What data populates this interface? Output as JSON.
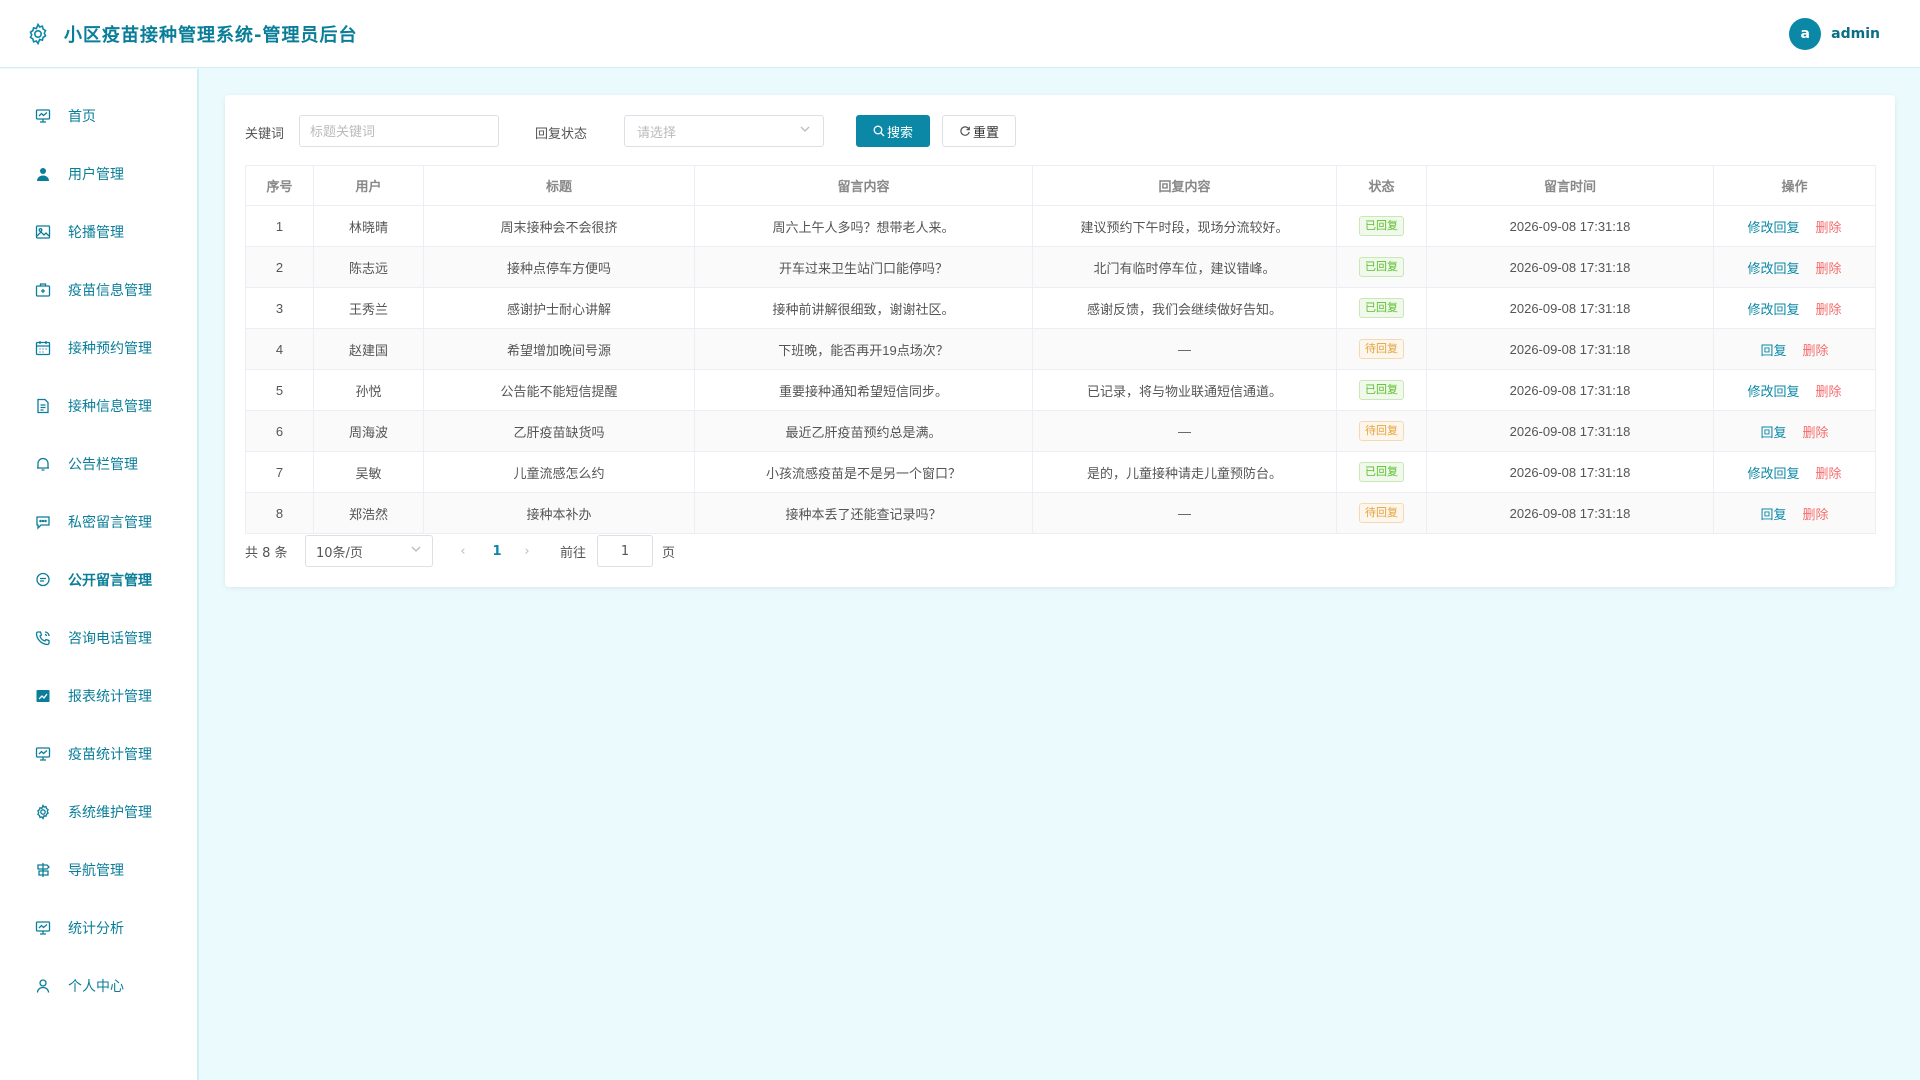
{
  "app": {
    "title": "小区疫苗接种管理系统-管理员后台",
    "accent": "#0a88a6"
  },
  "user": {
    "avatar_letter": "a",
    "name": "admin"
  },
  "sidebar": {
    "items": [
      {
        "label": "首页",
        "icon": "monitor-icon"
      },
      {
        "label": "用户管理",
        "icon": "user-icon"
      },
      {
        "label": "轮播管理",
        "icon": "picture-icon"
      },
      {
        "label": "疫苗信息管理",
        "icon": "first-aid-kit-icon"
      },
      {
        "label": "接种预约管理",
        "icon": "calendar-icon"
      },
      {
        "label": "接种信息管理",
        "icon": "document-icon"
      },
      {
        "label": "公告栏管理",
        "icon": "bell-icon"
      },
      {
        "label": "私密留言管理",
        "icon": "chat-dots-icon"
      },
      {
        "label": "公开留言管理",
        "icon": "chat-line-icon",
        "active": true
      },
      {
        "label": "咨询电话管理",
        "icon": "phone-icon"
      },
      {
        "label": "报表统计管理",
        "icon": "data-line-icon"
      },
      {
        "label": "疫苗统计管理",
        "icon": "monitor-icon"
      },
      {
        "label": "系统维护管理",
        "icon": "setting-icon"
      },
      {
        "label": "导航管理",
        "icon": "guide-icon"
      },
      {
        "label": "统计分析",
        "icon": "monitor-icon"
      },
      {
        "label": "个人中心",
        "icon": "user-outline-icon"
      }
    ]
  },
  "filter": {
    "keyword_label": "关键词",
    "keyword_placeholder": "标题关键词",
    "status_label": "回复状态",
    "status_placeholder": "请选择",
    "search_button": "搜索",
    "reset_button": "重置"
  },
  "table": {
    "headers": [
      "序号",
      "用户",
      "标题",
      "留言内容",
      "回复内容",
      "状态",
      "留言时间",
      "操作"
    ],
    "rows": [
      {
        "no": "1",
        "user": "林晓晴",
        "title": "周末接种会不会很挤",
        "content": "周六上午人多吗？想带老人来。",
        "reply": "建议预约下午时段，现场分流较好。",
        "status": "已回复",
        "status_type": "done",
        "time": "2026-09-08 17:31:18",
        "op_reply": "修改回复",
        "op_del": "删除"
      },
      {
        "no": "2",
        "user": "陈志远",
        "title": "接种点停车方便吗",
        "content": "开车过来卫生站门口能停吗？",
        "reply": "北门有临时停车位，建议错峰。",
        "status": "已回复",
        "status_type": "done",
        "time": "2026-09-08 17:31:18",
        "op_reply": "修改回复",
        "op_del": "删除"
      },
      {
        "no": "3",
        "user": "王秀兰",
        "title": "感谢护士耐心讲解",
        "content": "接种前讲解很细致，谢谢社区。",
        "reply": "感谢反馈，我们会继续做好告知。",
        "status": "已回复",
        "status_type": "done",
        "time": "2026-09-08 17:31:18",
        "op_reply": "修改回复",
        "op_del": "删除"
      },
      {
        "no": "4",
        "user": "赵建国",
        "title": "希望增加晚间号源",
        "content": "下班晚，能否再开19点场次？",
        "reply": "—",
        "status": "待回复",
        "status_type": "pending",
        "time": "2026-09-08 17:31:18",
        "op_reply": "回复",
        "op_del": "删除"
      },
      {
        "no": "5",
        "user": "孙悦",
        "title": "公告能不能短信提醒",
        "content": "重要接种通知希望短信同步。",
        "reply": "已记录，将与物业联通短信通道。",
        "status": "已回复",
        "status_type": "done",
        "time": "2026-09-08 17:31:18",
        "op_reply": "修改回复",
        "op_del": "删除"
      },
      {
        "no": "6",
        "user": "周海波",
        "title": "乙肝疫苗缺货吗",
        "content": "最近乙肝疫苗预约总是满。",
        "reply": "—",
        "status": "待回复",
        "status_type": "pending",
        "time": "2026-09-08 17:31:18",
        "op_reply": "回复",
        "op_del": "删除"
      },
      {
        "no": "7",
        "user": "吴敏",
        "title": "儿童流感怎么约",
        "content": "小孩流感疫苗是不是另一个窗口？",
        "reply": "是的，儿童接种请走儿童预防台。",
        "status": "已回复",
        "status_type": "done",
        "time": "2026-09-08 17:31:18",
        "op_reply": "修改回复",
        "op_del": "删除"
      },
      {
        "no": "8",
        "user": "郑浩然",
        "title": "接种本补办",
        "content": "接种本丢了还能查记录吗？",
        "reply": "—",
        "status": "待回复",
        "status_type": "pending",
        "time": "2026-09-08 17:31:18",
        "op_reply": "回复",
        "op_del": "删除"
      }
    ]
  },
  "pagination": {
    "total_text": "共 8 条",
    "page_size": "10条/页",
    "current_page": "1",
    "goto_label": "前往",
    "goto_value": "1",
    "page_suffix": "页"
  }
}
